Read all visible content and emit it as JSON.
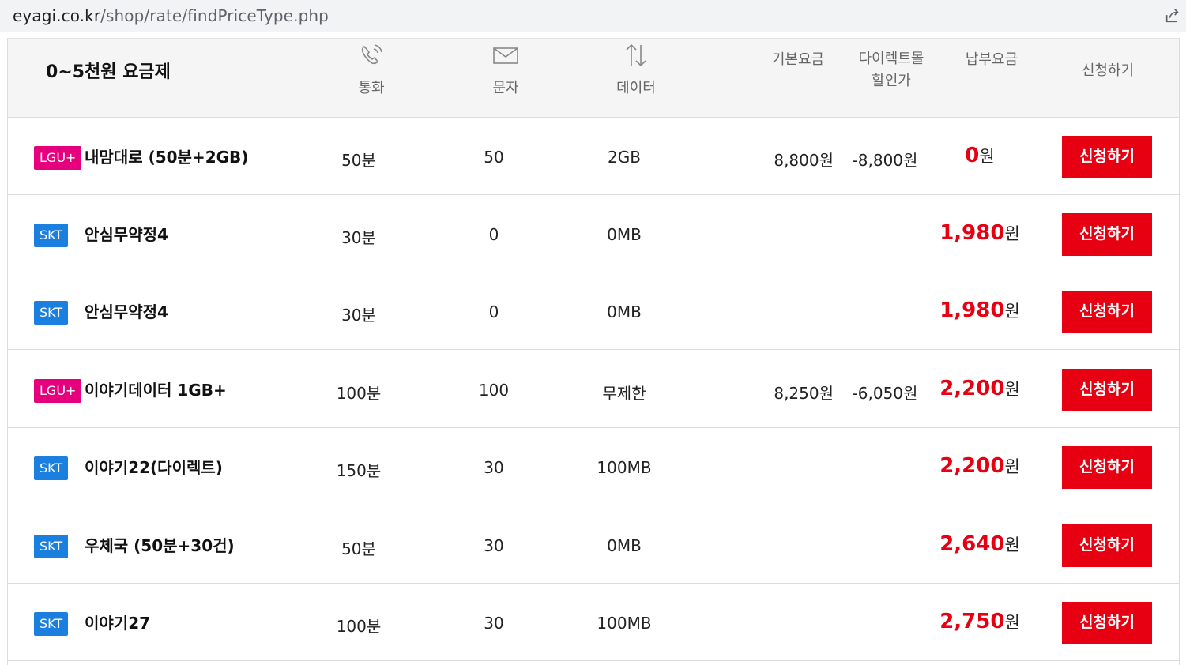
{
  "browser": {
    "url_domain": "eyagi.co.kr",
    "url_path": "/shop/rate/findPriceType.php"
  },
  "header": {
    "title": "0~5천원 요금제",
    "col_call": "통화",
    "col_sms": "문자",
    "col_data": "데이터",
    "col_base": "기본요금",
    "col_discount_line1": "다이렉트몰",
    "col_discount_line2": "할인가",
    "col_pay": "납부요금",
    "col_apply": "신청하기"
  },
  "rows": [
    {
      "carrier": "LGU+",
      "carrier_color": "#e6007e",
      "name": "내맘대로 (50분+2GB)",
      "call": "50분",
      "sms": "50",
      "data": "2GB",
      "base": "8,800원",
      "discount": "-8,800원",
      "pay": "0",
      "won": "원",
      "apply": "신청하기"
    },
    {
      "carrier": "SKT",
      "carrier_color": "#1b7fe0",
      "name": "안심무약정4",
      "call": "30분",
      "sms": "0",
      "data": "0MB",
      "base": "",
      "discount": "",
      "pay": "1,980",
      "won": "원",
      "apply": "신청하기"
    },
    {
      "carrier": "SKT",
      "carrier_color": "#1b7fe0",
      "name": "안심무약정4",
      "call": "30분",
      "sms": "0",
      "data": "0MB",
      "base": "",
      "discount": "",
      "pay": "1,980",
      "won": "원",
      "apply": "신청하기"
    },
    {
      "carrier": "LGU+",
      "carrier_color": "#e6007e",
      "name": "이야기데이터 1GB+",
      "call": "100분",
      "sms": "100",
      "data": "무제한",
      "base": "8,250원",
      "discount": "-6,050원",
      "pay": "2,200",
      "won": "원",
      "apply": "신청하기"
    },
    {
      "carrier": "SKT",
      "carrier_color": "#1b7fe0",
      "name": "이야기22(다이렉트)",
      "call": "150분",
      "sms": "30",
      "data": "100MB",
      "base": "",
      "discount": "",
      "pay": "2,200",
      "won": "원",
      "apply": "신청하기"
    },
    {
      "carrier": "SKT",
      "carrier_color": "#1b7fe0",
      "name": "우체국 (50분+30건)",
      "call": "50분",
      "sms": "30",
      "data": "0MB",
      "base": "",
      "discount": "",
      "pay": "2,640",
      "won": "원",
      "apply": "신청하기"
    },
    {
      "carrier": "SKT",
      "carrier_color": "#1b7fe0",
      "name": "이야기27",
      "call": "100분",
      "sms": "30",
      "data": "100MB",
      "base": "",
      "discount": "",
      "pay": "2,750",
      "won": "원",
      "apply": "신청하기"
    }
  ],
  "colors": {
    "accent_red": "#e60012",
    "lgu_pink": "#e6007e",
    "skt_blue": "#1b7fe0"
  }
}
